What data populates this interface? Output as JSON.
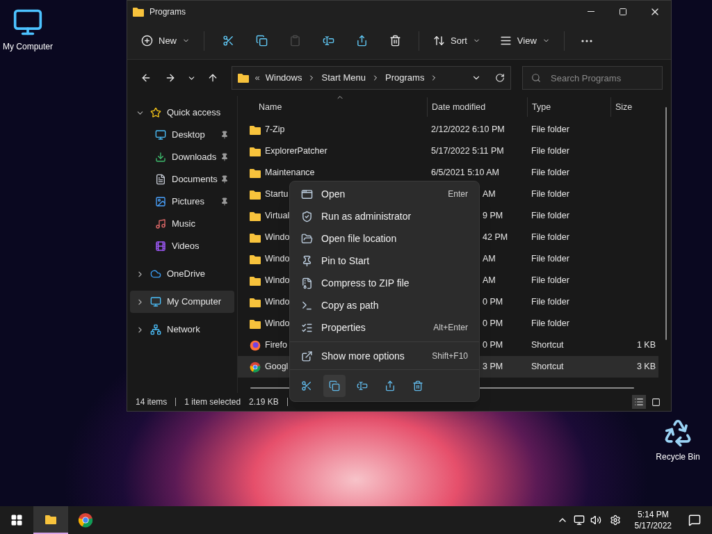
{
  "desktop_icons": [
    {
      "label": "My Computer"
    },
    {
      "label": "Recycle Bin"
    }
  ],
  "window": {
    "title": "Programs"
  },
  "toolbar": {
    "new_label": "New",
    "sort_label": "Sort",
    "view_label": "View",
    "paste_disabled": true
  },
  "address": {
    "prefix": "«",
    "segments": [
      "Windows",
      "Start Menu",
      "Programs"
    ]
  },
  "search": {
    "placeholder": "Search Programs"
  },
  "sidebar": {
    "items": [
      {
        "label": "Quick access",
        "expanded": true,
        "selected": false,
        "children": [
          {
            "label": "Desktop",
            "pinned": true,
            "selected": false
          },
          {
            "label": "Downloads",
            "pinned": true,
            "selected": false
          },
          {
            "label": "Documents",
            "pinned": true,
            "selected": false
          },
          {
            "label": "Pictures",
            "pinned": true,
            "selected": false
          },
          {
            "label": "Music",
            "pinned": false,
            "selected": false
          },
          {
            "label": "Videos",
            "pinned": false,
            "selected": false
          }
        ]
      },
      {
        "label": "OneDrive",
        "expanded": false,
        "selected": false
      },
      {
        "label": "My Computer",
        "expanded": false,
        "selected": true
      },
      {
        "label": "Network",
        "expanded": false,
        "selected": false
      }
    ]
  },
  "table": {
    "columns": [
      "Name",
      "Date modified",
      "Type",
      "Size"
    ],
    "rows": [
      {
        "kind": "folder",
        "name": "7-Zip",
        "date": "2/12/2022 6:10 PM",
        "type": "File folder",
        "covered": false,
        "selected": false
      },
      {
        "kind": "folder",
        "name": "ExplorerPatcher",
        "date": "5/17/2022 5:11 PM",
        "type": "File folder",
        "covered": false,
        "selected": false
      },
      {
        "kind": "folder",
        "name": "Maintenance",
        "date": "6/5/2021 5:10 AM",
        "type": "File folder",
        "covered": false,
        "selected": false
      },
      {
        "kind": "folder",
        "name": "Startu",
        "date": "AM",
        "type": "File folder",
        "covered": true,
        "selected": false
      },
      {
        "kind": "folder",
        "name": "Virtual",
        "date": "9 PM",
        "type": "File folder",
        "covered": true,
        "selected": false
      },
      {
        "kind": "folder",
        "name": "Windo",
        "date": "42 PM",
        "type": "File folder",
        "covered": true,
        "selected": false
      },
      {
        "kind": "folder",
        "name": "Windo",
        "date": "AM",
        "type": "File folder",
        "covered": true,
        "selected": false
      },
      {
        "kind": "folder",
        "name": "Windo",
        "date": "AM",
        "type": "File folder",
        "covered": true,
        "selected": false
      },
      {
        "kind": "folder",
        "name": "Windo",
        "date": "0 PM",
        "type": "File folder",
        "covered": true,
        "selected": false
      },
      {
        "kind": "folder",
        "name": "Windo",
        "date": "0 PM",
        "type": "File folder",
        "covered": true,
        "selected": false
      },
      {
        "kind": "firefox",
        "name": "Firefo",
        "date": "0 PM",
        "type": "Shortcut",
        "size": "1 KB",
        "covered": true,
        "selected": false
      },
      {
        "kind": "chrome",
        "name": "Googl",
        "date": "3 PM",
        "type": "Shortcut",
        "size": "3 KB",
        "covered": true,
        "selected": true
      }
    ]
  },
  "status_bar": {
    "count": "14 items",
    "selection": "1 item selected",
    "size": "2.19 KB"
  },
  "context_menu": {
    "items": [
      {
        "label": "Open",
        "shortcut": "Enter"
      },
      {
        "label": "Run as administrator"
      },
      {
        "label": "Open file location"
      },
      {
        "label": "Pin to Start"
      },
      {
        "label": "Compress to ZIP file"
      },
      {
        "label": "Copy as path"
      },
      {
        "label": "Properties",
        "shortcut": "Alt+Enter"
      },
      {
        "label": "Show more options",
        "shortcut": "Shift+F10"
      }
    ],
    "actions": [
      {
        "selected": false
      },
      {
        "selected": true
      },
      {
        "selected": false
      },
      {
        "selected": false
      },
      {
        "selected": false
      }
    ]
  },
  "taskbar": {
    "apps": [
      {
        "selected": true
      },
      {
        "selected": false
      }
    ],
    "time": "5:14 PM",
    "date": "5/17/2022"
  }
}
